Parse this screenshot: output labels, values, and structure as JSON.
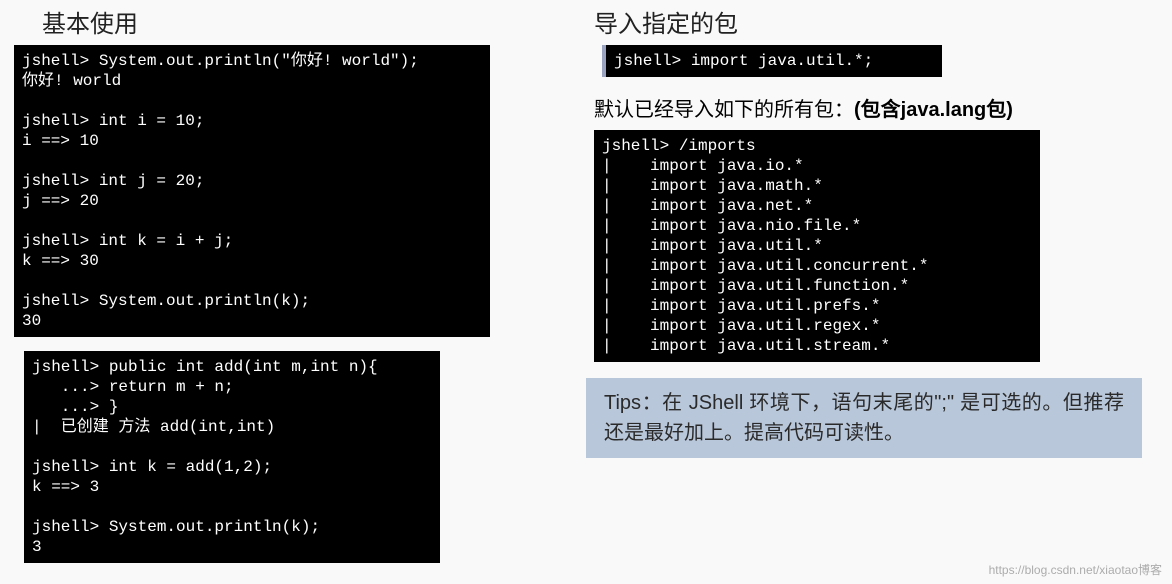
{
  "left": {
    "heading": "基本使用",
    "term1": "jshell> System.out.println(\"你好! world\");\n你好! world\n\njshell> int i = 10;\ni ==> 10\n\njshell> int j = 20;\nj ==> 20\n\njshell> int k = i + j;\nk ==> 30\n\njshell> System.out.println(k);\n30",
    "term2": "jshell> public int add(int m,int n){\n   ...> return m + n;\n   ...> }\n|  已创建 方法 add(int,int)\n\njshell> int k = add(1,2);\nk ==> 3\n\njshell> System.out.println(k);\n3"
  },
  "right": {
    "heading": "导入指定的包",
    "term1": "jshell> import java.util.*;",
    "subheading_prefix": "默认已经导入如下的所有包：",
    "subheading_bold": "(包含java.lang包)",
    "term2": "jshell> /imports\n|    import java.io.*\n|    import java.math.*\n|    import java.net.*\n|    import java.nio.file.*\n|    import java.util.*\n|    import java.util.concurrent.*\n|    import java.util.function.*\n|    import java.util.prefs.*\n|    import java.util.regex.*\n|    import java.util.stream.*",
    "tips": "Tips：在 JShell 环境下，语句末尾的\";\" 是可选的。但推荐还是最好加上。提高代码可读性。"
  },
  "watermark": "https://blog.csdn.net/xiaotao博客"
}
